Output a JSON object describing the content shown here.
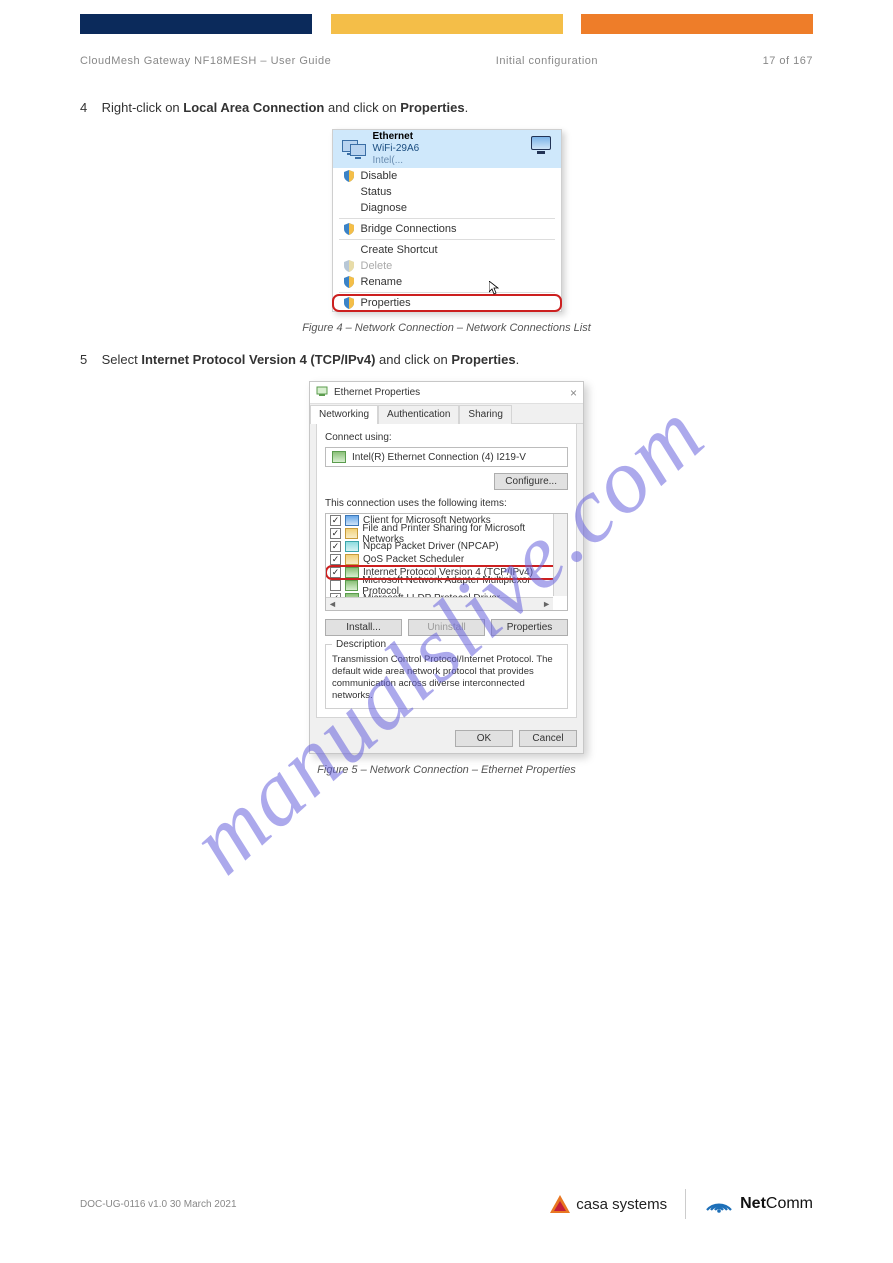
{
  "header": {
    "product": "CloudMesh Gateway NF18MESH – User Guide",
    "section": "Initial configuration",
    "page_of": "17 of 167"
  },
  "steps": {
    "s4": {
      "num": "4",
      "text_pre": "Right-click on ",
      "bold1": "Local Area Connection",
      "text_mid": " and click on ",
      "bold2": "Properties",
      "text_post": "."
    },
    "s5": {
      "num": "5",
      "text_pre": "Select ",
      "bold1": "Internet Protocol Version 4 (TCP/IPv4)",
      "text_mid": " and click on ",
      "bold2": "Properties",
      "text_post": "."
    }
  },
  "captions": {
    "fig4": "Figure 4 – Network Connection – Network Connections List",
    "fig5": "Figure 5 – Network Connection – Ethernet Properties"
  },
  "context_menu": {
    "net_name": "Ethernet",
    "ssid": "WiFi-29A6",
    "nic_hint": "Intel(...",
    "items": [
      {
        "label": "Disable",
        "shield": true
      },
      {
        "label": "Status",
        "shield": false
      },
      {
        "label": "Diagnose",
        "shield": false
      }
    ],
    "bridge": {
      "label": "Bridge Connections",
      "shield": true
    },
    "items2": [
      {
        "label": "Create Shortcut",
        "shield": false
      },
      {
        "label": "Delete",
        "shield": true,
        "disabled": true
      },
      {
        "label": "Rename",
        "shield": true
      }
    ],
    "properties": {
      "label": "Properties",
      "shield": true
    }
  },
  "dialog": {
    "title": "Ethernet Properties",
    "tabs": {
      "networking": "Networking",
      "auth": "Authentication",
      "sharing": "Sharing"
    },
    "connect_using_label": "Connect using:",
    "adapter": "Intel(R) Ethernet Connection (4) I219-V",
    "configure": "Configure...",
    "uses_label": "This connection uses the following items:",
    "items": [
      {
        "label": "Client for Microsoft Networks",
        "checked": true,
        "ic": "client"
      },
      {
        "label": "File and Printer Sharing for Microsoft Networks",
        "checked": true,
        "ic": "file"
      },
      {
        "label": "Npcap Packet Driver (NPCAP)",
        "checked": true,
        "ic": "npcap"
      },
      {
        "label": "QoS Packet Scheduler",
        "checked": true,
        "ic": "qos"
      },
      {
        "label": "Internet Protocol Version 4 (TCP/IPv4)",
        "checked": true,
        "ic": "ipv4",
        "hl": true
      },
      {
        "label": "Microsoft Network Adapter Multiplexor Protocol",
        "checked": false,
        "ic": "mux"
      },
      {
        "label": "Microsoft LLDP Protocol Driver",
        "checked": true,
        "ic": "lldp"
      }
    ],
    "install": "Install...",
    "uninstall": "Uninstall",
    "properties": "Properties",
    "desc_legend": "Description",
    "desc_text": "Transmission Control Protocol/Internet Protocol. The default wide area network protocol that provides communication across diverse interconnected networks.",
    "ok": "OK",
    "cancel": "Cancel"
  },
  "watermark": "manualslive.com",
  "footer": {
    "doc_code": "DOC-UG-0116 v1.0   30 March 2021",
    "casa": "casa systems",
    "netcomm": {
      "a": "Net",
      "b": "Comm"
    }
  }
}
